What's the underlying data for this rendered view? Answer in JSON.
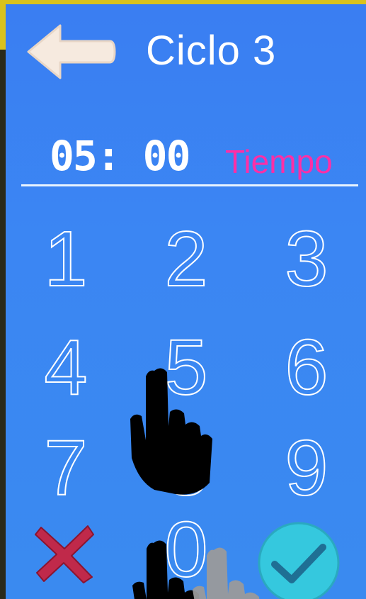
{
  "header": {
    "title": "Ciclo 3",
    "back_icon": "arrow-left-icon"
  },
  "display": {
    "time": "05: 00",
    "label": "Tiempo"
  },
  "keypad": {
    "keys": [
      "1",
      "2",
      "3",
      "4",
      "5",
      "6",
      "7",
      "8",
      "9",
      "0"
    ],
    "cancel_icon": "x-icon",
    "confirm_icon": "checkmark-icon"
  },
  "colors": {
    "background": "#3a86f2",
    "text": "#ffffff",
    "time_label": "#ff2fa6",
    "cancel": "#c0294a",
    "confirm": "#35c8de"
  }
}
